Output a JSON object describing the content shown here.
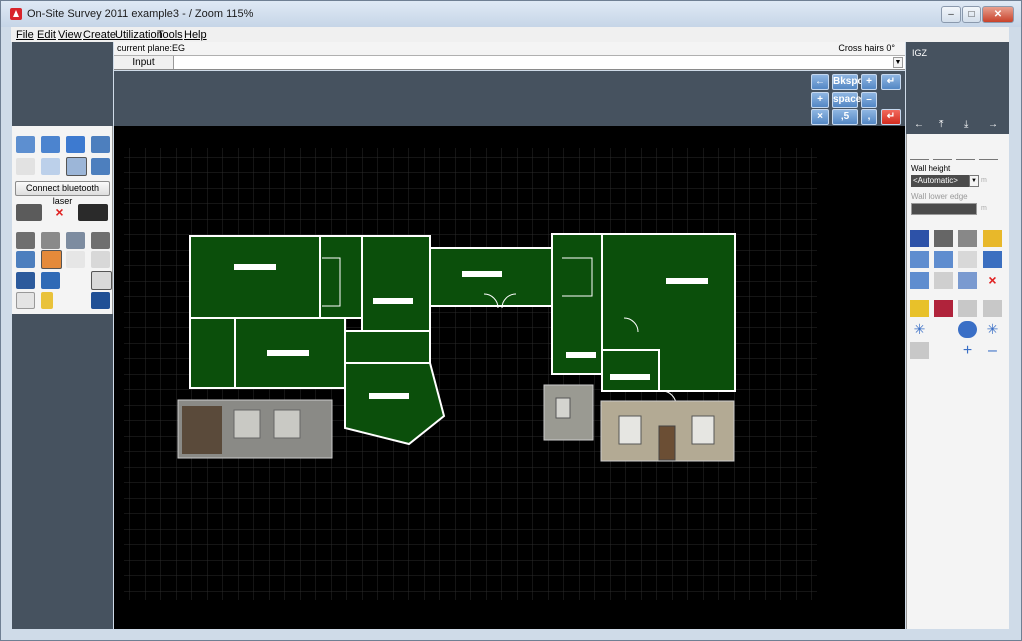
{
  "window": {
    "title": "On-Site Survey 2011   example3 -  / Zoom 115%",
    "controls": {
      "minimize": "–",
      "maximize": "□",
      "close": "✕"
    }
  },
  "menu": [
    "File",
    "Edit",
    "View",
    "Create",
    "Utilization",
    "Tools",
    "Help"
  ],
  "status": {
    "current_plane": "current plane:EG",
    "crosshair": "Cross hairs 0°"
  },
  "input": {
    "label": "Input",
    "value": ""
  },
  "keypad": {
    "rows": [
      [
        "←",
        "Bkspc",
        "+",
        "↵"
      ],
      [
        "+",
        "space",
        "–"
      ],
      [
        "×",
        ",5",
        ",",
        "↵"
      ]
    ]
  },
  "left_toolbox": {
    "bluetooth_button": "Connect bluetooth laser",
    "icons": [
      "floor-plan-icon",
      "cube-icon",
      "box-icon",
      "layout-icon",
      "undo-icon",
      "rotate-box-icon",
      "active-box-icon",
      "compass-icon",
      "laser-device-icon",
      "delete-x-icon",
      "laser-meter-icon",
      "camera-icon",
      "scanner-icon",
      "split-icon",
      "camera-icon",
      "layers-icon",
      "color-layers-icon",
      "page-icon",
      "pen-icon",
      "save-floor-icon",
      "save-box-icon",
      "color-pen-icon",
      "notes-icon",
      "traffic-light-icon",
      "disk-icon"
    ]
  },
  "right_panel": {
    "label": "IGZ",
    "nav_arrows": [
      "←",
      "⤒",
      "⤓",
      "→"
    ],
    "wall_height_label": "Wall height",
    "wall_height_value": "<Automatic>",
    "wall_height_unit": "m",
    "wall_lower_edge_label": "Wall lower edge",
    "wall_lower_edge_unit": "m",
    "icons": [
      "wall-tool-1-icon",
      "wall-tool-2-icon",
      "wall-tool-3-icon",
      "wall-tool-4-icon",
      "text-m-icon",
      "cut-icon",
      "measure-icon",
      "ruler-help-icon",
      "copy-icon",
      "move-icon",
      "shape-icon",
      "tree-icon",
      "page-icon",
      "pages-icon",
      "triangle-icon",
      "close-x-icon",
      "info-icon",
      "grid-icon",
      "undo-icon",
      "redo-icon",
      "asterisk-icon",
      "zoom-icon",
      "star-icon",
      "eraser-icon",
      "plus-icon",
      "minus-icon"
    ]
  },
  "colors": {
    "canvas_bg": "#000000",
    "room_fill": "#0b4f0b",
    "wall": "#ffffff",
    "grid": "#2a2a2a",
    "panel_gray": "#46525f",
    "key_blue": "#5487c4",
    "key_red": "#d22c1f"
  }
}
